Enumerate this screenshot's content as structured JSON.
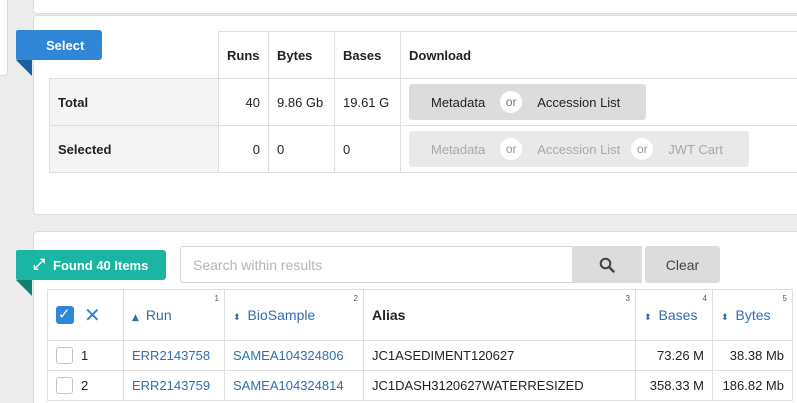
{
  "select_panel": {
    "ribbon_label": "Select",
    "headers": {
      "runs": "Runs",
      "bytes": "Bytes",
      "bases": "Bases",
      "download": "Download"
    },
    "total": {
      "label": "Total",
      "runs": "40",
      "bytes": "9.86 Gb",
      "bases": "19.61 G",
      "metadata": "Metadata",
      "or": "or",
      "accession_list": "Accession List"
    },
    "selected": {
      "label": "Selected",
      "runs": "0",
      "bytes": "0",
      "bases": "0",
      "metadata": "Metadata",
      "or1": "or",
      "accession_list": "Accession List",
      "or2": "or",
      "jwt_cart": "JWT Cart"
    }
  },
  "results_panel": {
    "ribbon_label": "Found 40 Items",
    "search": {
      "placeholder": "Search within results",
      "value": ""
    },
    "clear_label": "Clear",
    "columns": [
      {
        "label": "Run",
        "num": "1"
      },
      {
        "label": "BioSample",
        "num": "2"
      },
      {
        "label": "Alias",
        "num": "3"
      },
      {
        "label": "Bases",
        "num": "4"
      },
      {
        "label": "Bytes",
        "num": "5"
      }
    ],
    "rows": [
      {
        "index": "1",
        "run": "ERR2143758",
        "biosample": "SAMEA104324806",
        "alias": "JC1ASEDIMENT120627",
        "bases": "73.26 M",
        "bytes": "38.38 Mb"
      },
      {
        "index": "2",
        "run": "ERR2143759",
        "biosample": "SAMEA104324814",
        "alias": "JC1DASH3120627WATERRESIZED",
        "bases": "358.33 M",
        "bytes": "186.82 Mb"
      }
    ]
  },
  "colors": {
    "select_blue": "#2f86d6",
    "found_teal": "#1bb5a3",
    "link_blue": "#2f6fb0"
  }
}
